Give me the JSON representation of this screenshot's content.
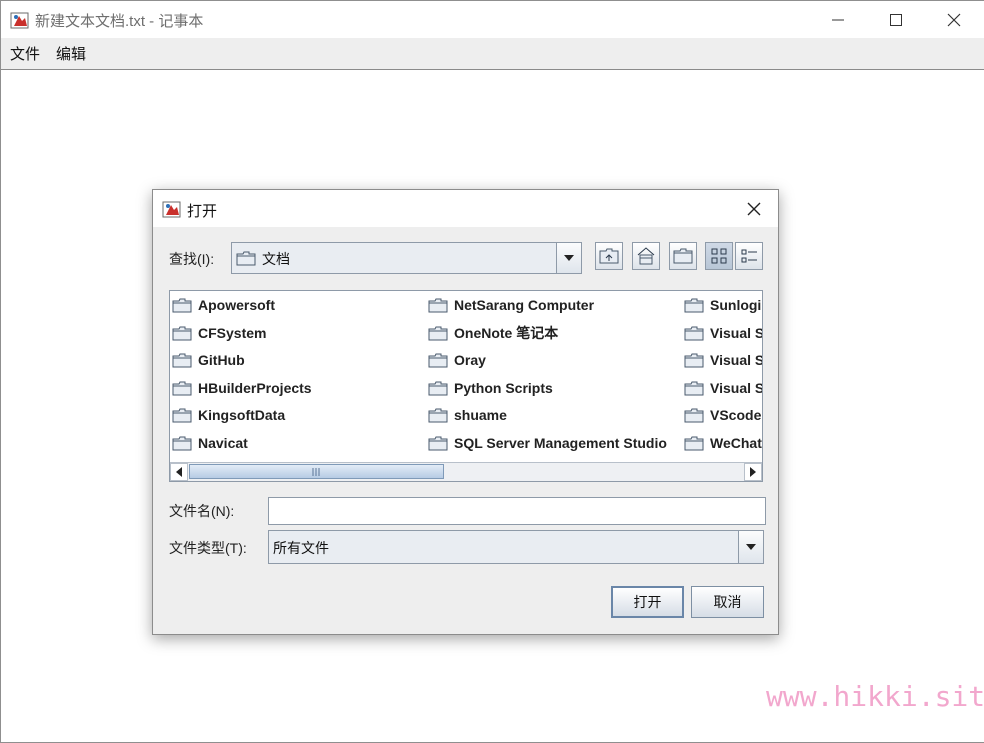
{
  "window": {
    "title": "新建文本文档.txt - 记事本"
  },
  "menu": {
    "items": [
      "文件",
      "编辑"
    ]
  },
  "dialog": {
    "title": "打开",
    "look_in_label": "查找(I):",
    "look_in_value": "文档",
    "files": {
      "col1": [
        "Apowersoft",
        "CFSystem",
        "GitHub",
        "HBuilderProjects",
        "KingsoftData",
        "Navicat"
      ],
      "col2": [
        "NetSarang Computer",
        "OneNote 笔记本",
        "Oray",
        "Python Scripts",
        "shuame",
        "SQL Server Management Studio"
      ],
      "col3": [
        "Sunlogi",
        "Visual S",
        "Visual S",
        "Visual S",
        "VScode",
        "WeChat"
      ]
    },
    "filename_label": "文件名(N):",
    "filename_value": "",
    "filetype_label": "文件类型(T):",
    "filetype_value": "所有文件",
    "open_button": "打开",
    "cancel_button": "取消"
  },
  "watermark": "www.hikki.site",
  "icons": [
    "app-icon",
    "minimize-icon",
    "maximize-icon",
    "close-icon",
    "folder-icon",
    "up-folder-icon",
    "home-icon",
    "new-folder-icon",
    "list-view-icon",
    "details-view-icon",
    "chevron-down-icon",
    "arrow-left-icon",
    "arrow-right-icon"
  ],
  "colors": {
    "accent_border": "#8e9aa8",
    "scroll_thumb": "#b6cbe4",
    "watermark": "#f2a7cd",
    "title_text": "#6e6e6e"
  }
}
